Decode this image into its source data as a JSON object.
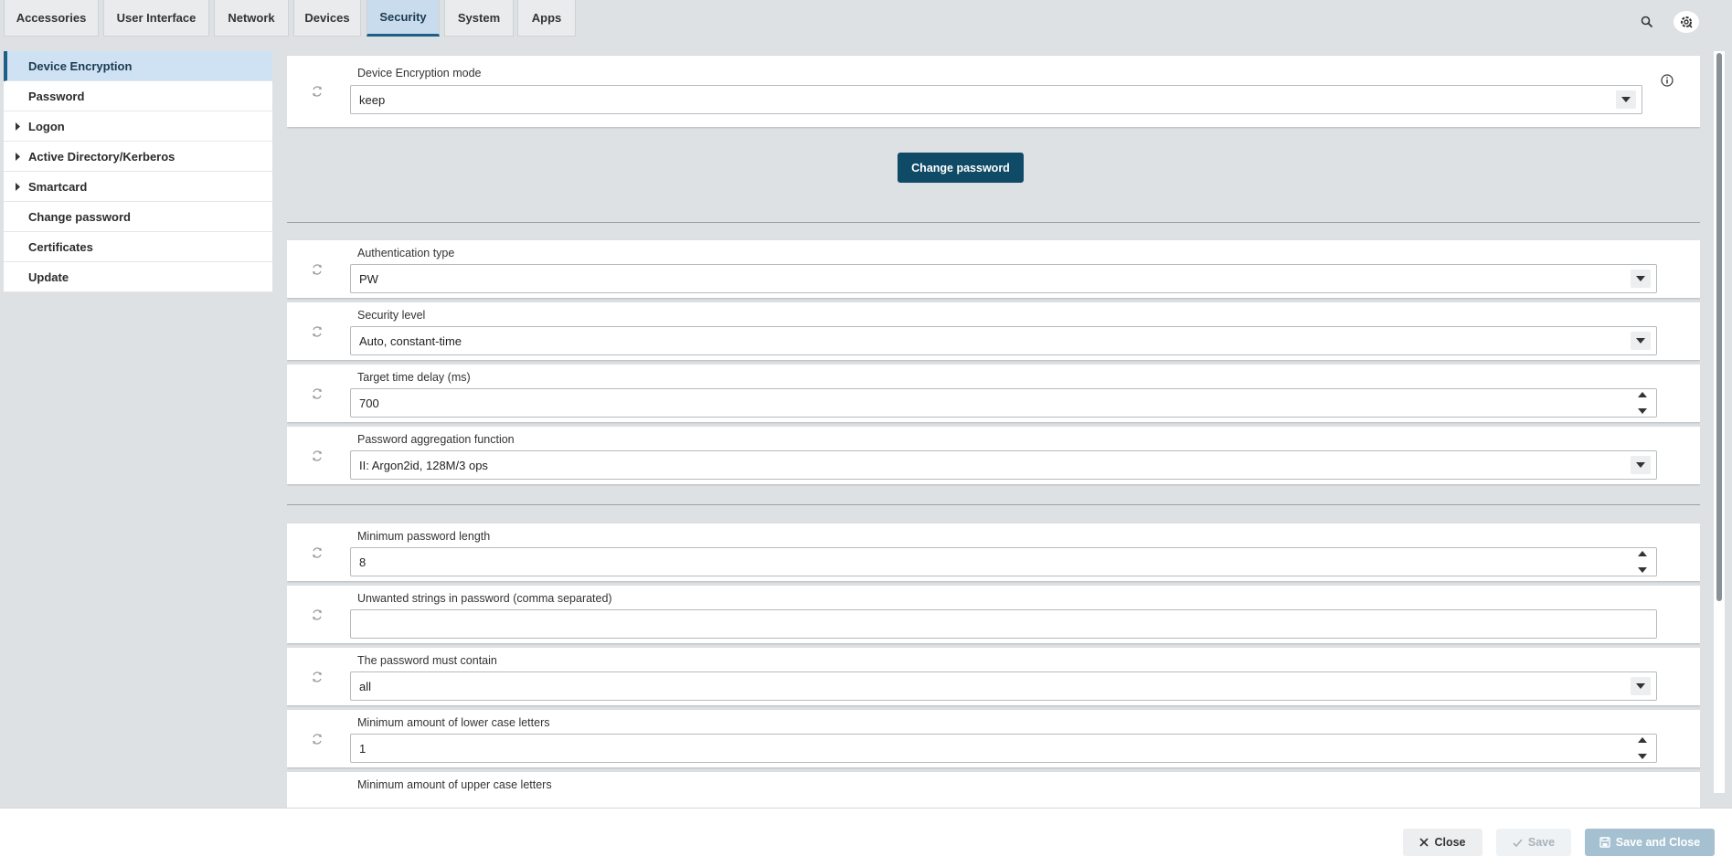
{
  "tabs": [
    {
      "label": "Accessories"
    },
    {
      "label": "User Interface"
    },
    {
      "label": "Network"
    },
    {
      "label": "Devices"
    },
    {
      "label": "Security",
      "active": true
    },
    {
      "label": "System"
    },
    {
      "label": "Apps"
    }
  ],
  "top_icons": [
    "search-icon",
    "settings-gear-icon"
  ],
  "sidebar": {
    "items": [
      {
        "label": "Device Encryption",
        "active": true
      },
      {
        "label": "Password"
      },
      {
        "label": "Logon",
        "expandable": true
      },
      {
        "label": "Active Directory/Kerberos",
        "expandable": true
      },
      {
        "label": "Smartcard",
        "expandable": true
      },
      {
        "label": "Change password"
      },
      {
        "label": "Certificates"
      },
      {
        "label": "Update"
      }
    ]
  },
  "encryption": {
    "mode_label": "Device Encryption mode",
    "mode_value": "keep",
    "change_password_button": "Change password"
  },
  "auth": {
    "type_label": "Authentication type",
    "type_value": "PW",
    "level_label": "Security level",
    "level_value": "Auto, constant-time",
    "delay_label": "Target time delay (ms)",
    "delay_value": "700",
    "aggregation_label": "Password aggregation function",
    "aggregation_value": "II: Argon2id, 128M/3 ops"
  },
  "policy": {
    "min_length_label": "Minimum password length",
    "min_length_value": "8",
    "unwanted_label": "Unwanted strings in password (comma separated)",
    "unwanted_value": "",
    "must_contain_label": "The password must contain",
    "must_contain_value": "all",
    "min_lower_label": "Minimum amount of lower case letters",
    "min_lower_value": "1",
    "min_upper_label": "Minimum amount of upper case letters"
  },
  "footer": {
    "close": "Close",
    "save": "Save",
    "save_and_close": "Save and Close"
  },
  "colors": {
    "accent": "#0f4a66",
    "active_tab_bg": "#c9dced",
    "background": "#dde1e4"
  }
}
